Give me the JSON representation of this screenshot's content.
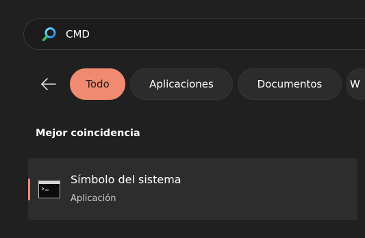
{
  "search": {
    "value": "CMD",
    "accent_color": "#4fc3f7"
  },
  "filters": {
    "back_icon": "arrow-left-icon",
    "chips": [
      {
        "label": "Todo",
        "active": true
      },
      {
        "label": "Aplicaciones",
        "active": false
      },
      {
        "label": "Documentos",
        "active": false
      },
      {
        "label": "W",
        "active": false
      }
    ],
    "active_color": "#f08a70"
  },
  "section": {
    "title": "Mejor coincidencia"
  },
  "result": {
    "icon": "command-prompt-icon",
    "name": "Símbolo del sistema",
    "type": "Aplicación"
  }
}
